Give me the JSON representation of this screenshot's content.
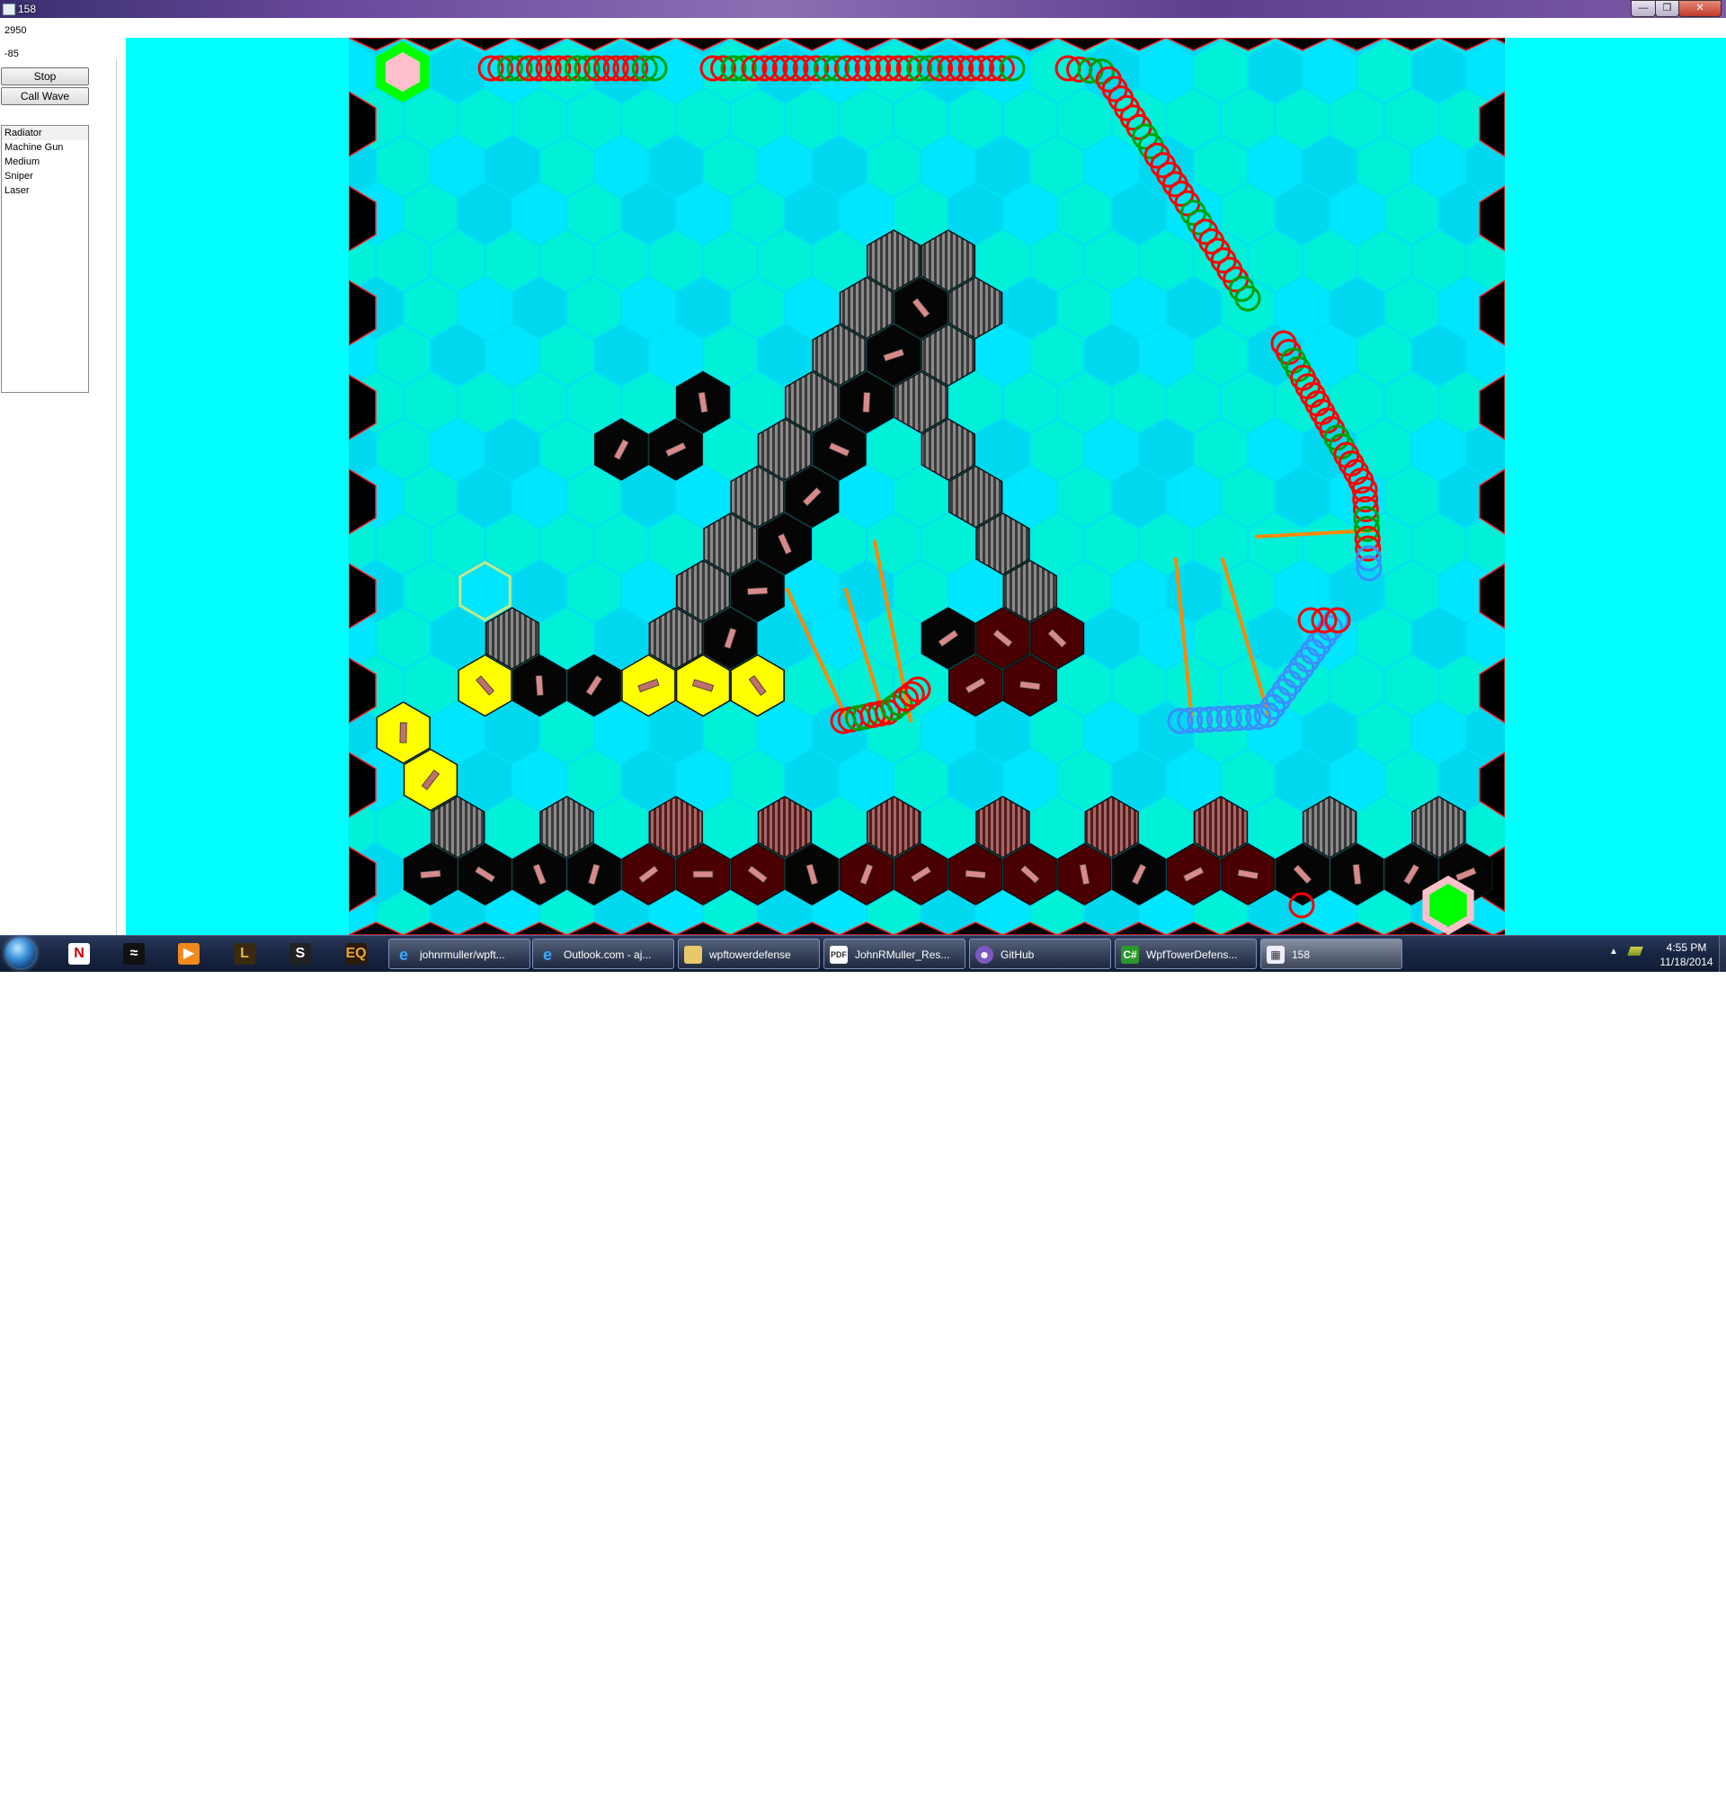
{
  "window": {
    "title": "158",
    "icon": "app-icon",
    "controls": [
      "minimize-icon",
      "maximize-icon",
      "close-icon"
    ]
  },
  "panel": {
    "money": "2950",
    "lives": "-85",
    "stop_label": "Stop",
    "call_wave_label": "Call Wave",
    "towers": [
      "Radiator",
      "Machine Gun",
      "Medium",
      "Sniper",
      "Laser"
    ],
    "selected_tower": "Radiator"
  },
  "colors": {
    "background": "#00ffff",
    "hex_light": "#00e6ff",
    "hex_mid": "#00d8f0",
    "hex_green": "#00f0d8",
    "wall": "#000000",
    "border_edge": "#ff2020",
    "tower_black": "#050505",
    "tower_dark_red": "#4a0000",
    "tower_yellow": "#ffff00",
    "tower_grey": "#555555",
    "creep_outline": "#ff0000",
    "creep_healthy": "#00a000",
    "creep_slowed": "#3a8fff",
    "laser": "#ff8800",
    "spawn_color": "#00ff00",
    "goal_color": "#ffc0cb"
  },
  "taskbar": {
    "pinned": [
      "netflix-icon",
      "steam-icon",
      "media-player-icon",
      "lotro-icon",
      "skype-s-icon",
      "everquest-icon"
    ],
    "tasks": [
      {
        "label": "johnrmuller/wpft...",
        "icon": "internet-explorer-icon"
      },
      {
        "label": "Outlook.com - aj...",
        "icon": "internet-explorer-icon"
      },
      {
        "label": "wpftowerdefense",
        "icon": "folder-icon"
      },
      {
        "label": "JohnRMuller_Res...",
        "icon": "pdf-icon"
      },
      {
        "label": "GitHub",
        "icon": "github-icon"
      },
      {
        "label": "WpfTowerDefens...",
        "icon": "csharp-icon"
      },
      {
        "label": "158",
        "icon": "app-icon"
      }
    ],
    "time": "4:55 PM",
    "date": "11/18/2014"
  }
}
